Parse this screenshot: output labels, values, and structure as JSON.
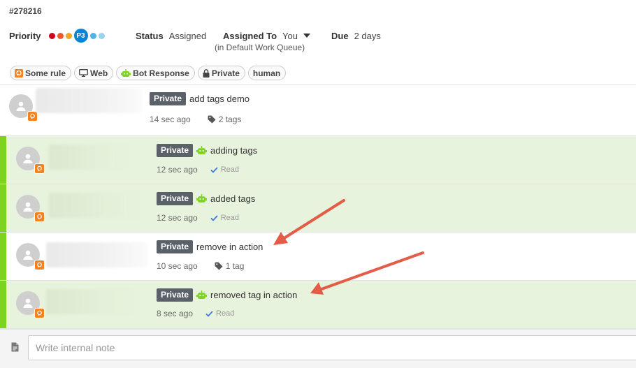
{
  "ticket": {
    "id": "#278216"
  },
  "meta": {
    "priority_label": "Priority",
    "priority_current": "P3",
    "priority_colors": [
      "#d0021b",
      "#f0592a",
      "#f5a623",
      "#0a84d6",
      "#4fb4e8",
      "#9ad3f2"
    ],
    "status_label": "Status",
    "status_value": "Assigned",
    "assigned_label": "Assigned To",
    "assigned_value": "You",
    "assigned_queue": "(in Default Work Queue)",
    "due_label": "Due",
    "due_value": "2 days"
  },
  "tags": [
    {
      "label": "Some rule",
      "icon": "rule-icon"
    },
    {
      "label": "Web",
      "icon": "monitor-icon"
    },
    {
      "label": "Bot Response",
      "icon": "bot-icon"
    },
    {
      "label": "Private",
      "icon": "lock-icon"
    },
    {
      "label": "human",
      "icon": ""
    }
  ],
  "messages": [
    {
      "badge": "Private",
      "text": "add tags demo",
      "time": "14 sec ago",
      "extra": "2 tags",
      "bot": false,
      "internal": false
    },
    {
      "badge": "Private",
      "text": "adding tags",
      "time": "12 sec ago",
      "extra": "Read",
      "bot": true,
      "internal": true
    },
    {
      "badge": "Private",
      "text": "added tags",
      "time": "12 sec ago",
      "extra": "Read",
      "bot": true,
      "internal": true
    },
    {
      "badge": "Private",
      "text": "remove in action",
      "time": "10 sec ago",
      "extra": "1 tag",
      "bot": false,
      "internal": false
    },
    {
      "badge": "Private",
      "text": "removed tag in action",
      "time": "8 sec ago",
      "extra": "Read",
      "bot": true,
      "internal": true
    }
  ],
  "composer": {
    "placeholder": "Write internal note"
  },
  "colors": {
    "accent_green": "#7ed321",
    "internal_bg": "#e7f3dc",
    "arrow": "#e25c47",
    "badge_orange": "#f5821f"
  }
}
